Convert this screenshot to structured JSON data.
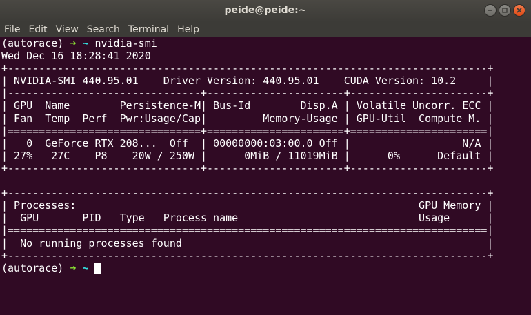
{
  "window": {
    "title": "peide@peide:~"
  },
  "menu": [
    "File",
    "Edit",
    "View",
    "Search",
    "Terminal",
    "Help"
  ],
  "prompt": {
    "env": "(autorace)",
    "arrow": "➜",
    "dir": "~"
  },
  "command": "nvidia-smi",
  "lines": [
    "Wed Dec 16 18:28:41 2020",
    "+-----------------------------------------------------------------------------+",
    "| NVIDIA-SMI 440.95.01    Driver Version: 440.95.01    CUDA Version: 10.2     |",
    "|-------------------------------+----------------------+----------------------+",
    "| GPU  Name        Persistence-M| Bus-Id        Disp.A | Volatile Uncorr. ECC |",
    "| Fan  Temp  Perf  Pwr:Usage/Cap|         Memory-Usage | GPU-Util  Compute M. |",
    "|===============================+======================+======================|",
    "|   0  GeForce RTX 208...  Off  | 00000000:03:00.0 Off |                  N/A |",
    "| 27%   27C    P8    20W / 250W |      0MiB / 11019MiB |      0%      Default |",
    "+-------------------------------+----------------------+----------------------+",
    "",
    "+-----------------------------------------------------------------------------+",
    "| Processes:                                                       GPU Memory |",
    "|  GPU       PID   Type   Process name                             Usage      |",
    "|=============================================================================|",
    "|  No running processes found                                                 |",
    "+-----------------------------------------------------------------------------+"
  ]
}
